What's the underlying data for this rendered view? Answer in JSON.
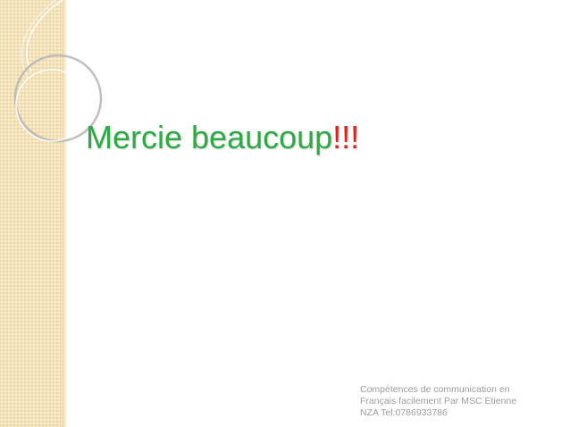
{
  "slide": {
    "title": {
      "main": "Mercie beaucoup",
      "emphasis": "!!!"
    },
    "footer_lines": [
      "Compétences de communication en",
      "Français facilement  Par MSC Etienne",
      "NZA  Tel:0786933786"
    ]
  },
  "colors": {
    "title": "#2eaa44",
    "emphasis": "#e0201c",
    "side_panel": "#f4e1b6",
    "footer_text": "#9c9c9c"
  }
}
